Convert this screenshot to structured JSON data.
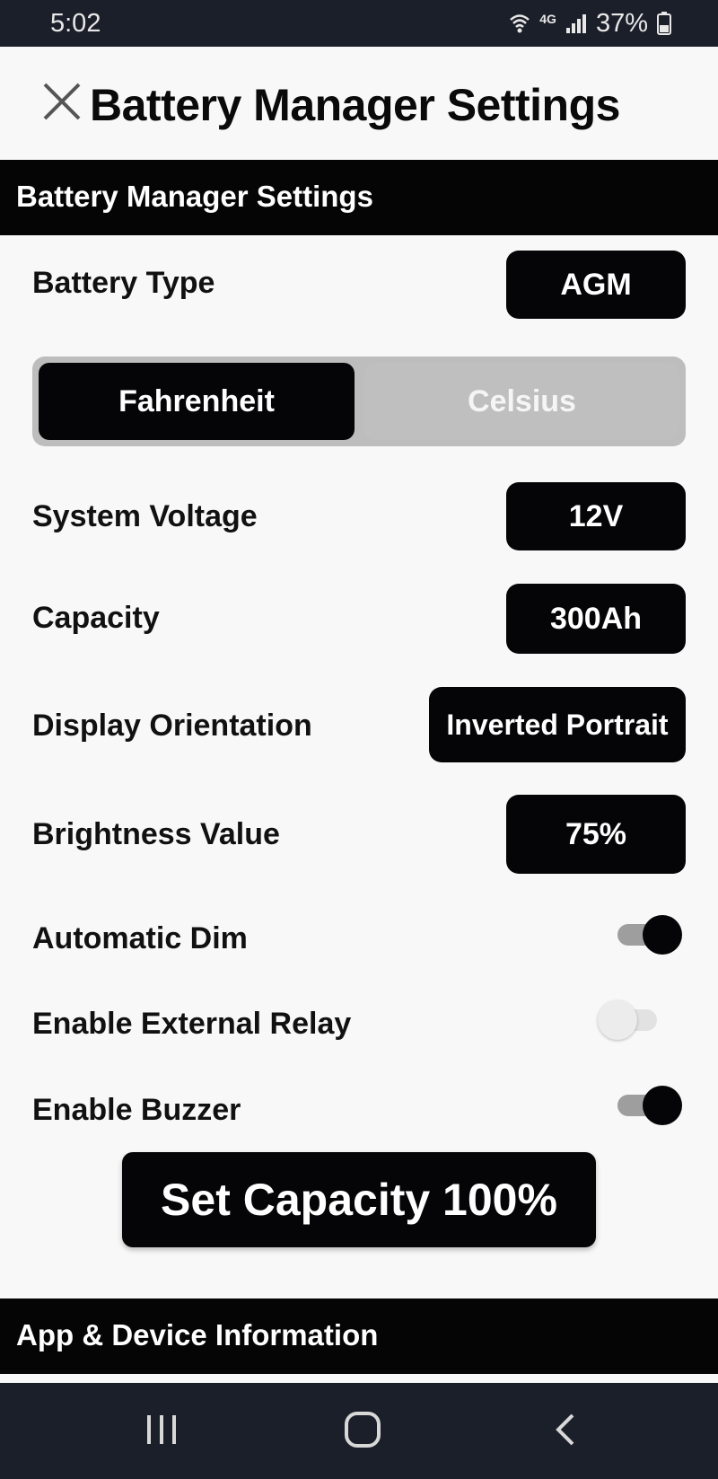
{
  "status_bar": {
    "time": "5:02",
    "network": "4G",
    "battery": "37%"
  },
  "app_bar": {
    "title": "Battery Manager Settings"
  },
  "sections": {
    "battery_manager": "Battery Manager Settings",
    "app_device_info": "App & Device Information"
  },
  "settings": {
    "battery_type": {
      "label": "Battery Type",
      "value": "AGM"
    },
    "temperature_unit": {
      "options": [
        "Fahrenheit",
        "Celsius"
      ],
      "selected": "Fahrenheit"
    },
    "system_voltage": {
      "label": "System Voltage",
      "value": "12V"
    },
    "capacity": {
      "label": "Capacity",
      "value": "300Ah"
    },
    "display_orientation": {
      "label": "Display Orientation",
      "value": "Inverted Portrait"
    },
    "brightness": {
      "label": "Brightness Value",
      "value": "75%"
    },
    "automatic_dim": {
      "label": "Automatic Dim",
      "enabled": true
    },
    "external_relay": {
      "label": "Enable External Relay",
      "enabled": false
    },
    "buzzer": {
      "label": "Enable Buzzer",
      "enabled": true
    }
  },
  "actions": {
    "set_capacity": "Set Capacity 100%"
  },
  "colors": {
    "accent": "#050507",
    "background": "#f8f8f8",
    "status_bar": "#1b1f2a"
  },
  "icons": [
    "wifi-icon",
    "signal-icon",
    "battery-icon",
    "close-icon",
    "recent-apps-icon",
    "home-icon",
    "back-icon"
  ]
}
